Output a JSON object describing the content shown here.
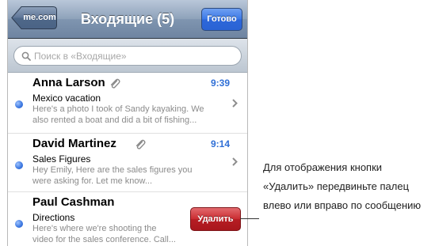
{
  "navbar": {
    "back_label": "me.com",
    "title": "Входящие (5)",
    "done_label": "Готово"
  },
  "search": {
    "placeholder": "Поиск в «Входящие»"
  },
  "messages": [
    {
      "sender": "Anna Larson",
      "has_attachment": true,
      "time": "9:39",
      "subject": "Mexico vacation",
      "preview_line1": "Here's a photo I took of Sandy kayaking. We",
      "preview_line2": "also rented a boat and did a bit of fishing..."
    },
    {
      "sender": "David Martinez",
      "has_attachment": true,
      "time": "9:14",
      "subject": "Sales Figures",
      "preview_line1": "Hey Emily, Here are the sales figures you",
      "preview_line2": "were asking for. Let me know..."
    },
    {
      "sender": "Paul Cashman",
      "has_attachment": false,
      "time": "",
      "subject": "Directions",
      "preview_line1": "Here's where we're shooting the",
      "preview_line2": "video for the sales conference. Call..."
    }
  ],
  "delete_button_label": "Удалить",
  "callout": {
    "text": "Для отображения кнопки «Удалить» передвиньте палец влево или вправо по сообщению"
  },
  "colors": {
    "unread_dot": "#3a76e0",
    "time_text": "#2f6fd6",
    "delete_button": "#c92c31",
    "done_button": "#3a78e6",
    "navbar": "#8ea2ba"
  }
}
